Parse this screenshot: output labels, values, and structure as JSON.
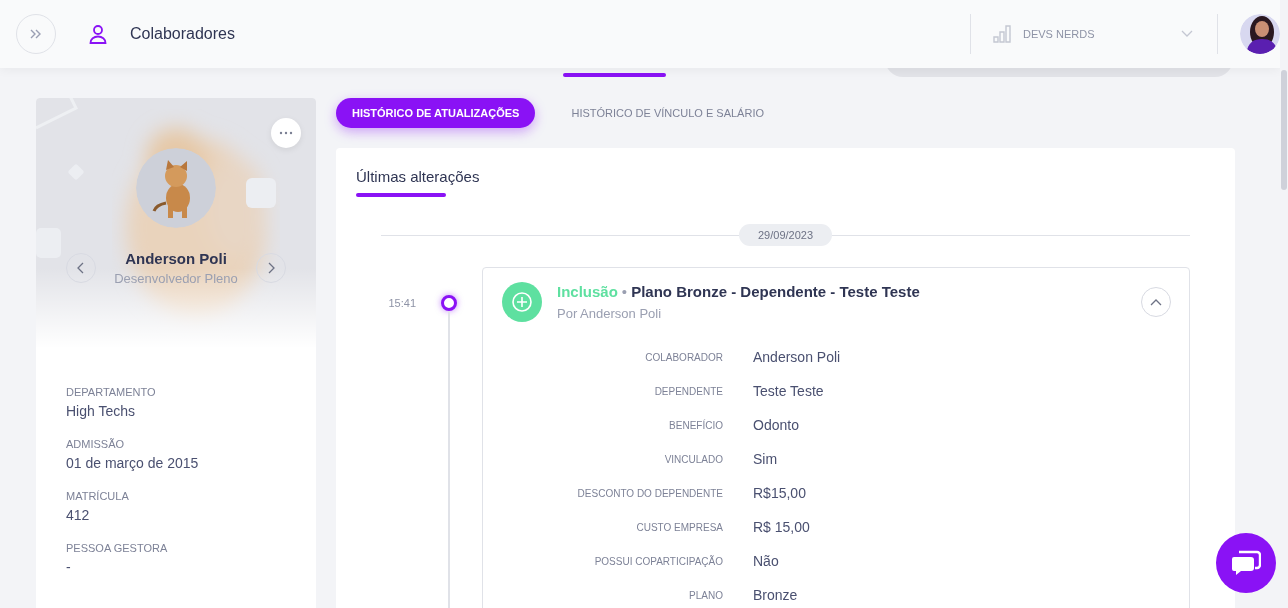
{
  "header": {
    "title": "Colaboradores",
    "company": "DEVS NERDS"
  },
  "profile": {
    "name": "Anderson Poli",
    "role": "Desenvolvedor Pleno",
    "fields": [
      {
        "label": "DEPARTAMENTO",
        "value": "High Techs"
      },
      {
        "label": "ADMISSÃO",
        "value": "01 de março de 2015"
      },
      {
        "label": "MATRÍCULA",
        "value": "412"
      },
      {
        "label": "PESSOA GESTORA",
        "value": "-"
      }
    ]
  },
  "tabs": [
    {
      "label": "HISTÓRICO DE ATUALIZAÇÕES",
      "selected": true
    },
    {
      "label": "HISTÓRICO DE VÍNCULO E SALÁRIO",
      "selected": false
    }
  ],
  "panel": {
    "title": "Últimas alterações",
    "date": "29/09/2023",
    "entries": [
      {
        "time": "15:41",
        "kind": "inclusion",
        "action": "Inclusão",
        "separator": "•",
        "title": "Plano Bronze - Dependente - Teste Teste",
        "author": "Por Anderson Poli",
        "expanded": true,
        "details": [
          {
            "label": "COLABORADOR",
            "value": "Anderson Poli"
          },
          {
            "label": "DEPENDENTE",
            "value": "Teste Teste"
          },
          {
            "label": "BENEFÍCIO",
            "value": "Odonto"
          },
          {
            "label": "VINCULADO",
            "value": "Sim"
          },
          {
            "label": "DESCONTO DO DEPENDENTE",
            "value": "R$15,00"
          },
          {
            "label": "CUSTO EMPRESA",
            "value": "R$ 15,00"
          },
          {
            "label": "POSSUI COPARTICIPAÇÃO",
            "value": "Não"
          },
          {
            "label": "PLANO",
            "value": "Bronze"
          }
        ]
      }
    ]
  }
}
